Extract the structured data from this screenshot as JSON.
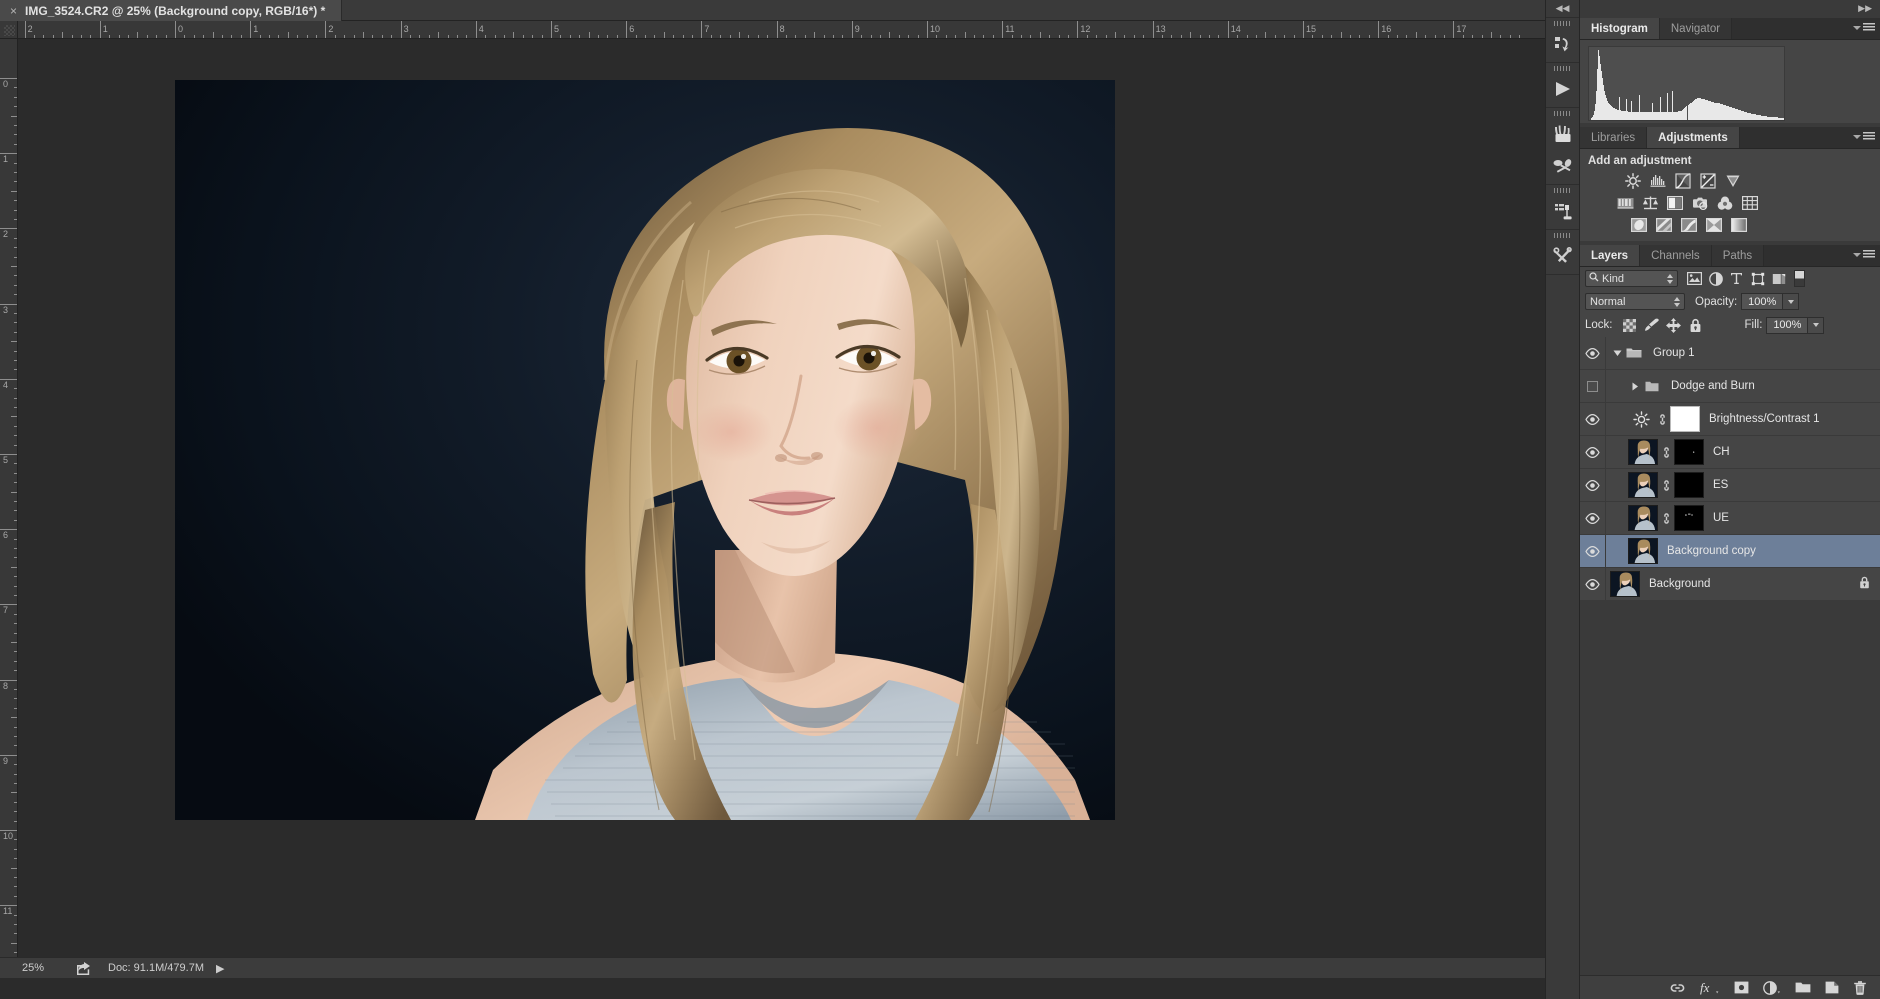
{
  "app": {
    "name": "Adobe Photoshop"
  },
  "document_tab": {
    "title": "IMG_3524.CR2 @ 25% (Background copy, RGB/16*) *",
    "close_glyph": "×"
  },
  "rulers": {
    "unit": "inches",
    "horizontal_labels": [
      "2",
      "1",
      "0",
      "1",
      "2",
      "3",
      "4",
      "5",
      "6",
      "7",
      "8",
      "9",
      "10",
      "11",
      "12",
      "13",
      "14",
      "15",
      "16",
      "17"
    ],
    "vertical_labels": [
      "0",
      "1",
      "2",
      "3",
      "4",
      "5",
      "6",
      "7",
      "8",
      "9",
      "10",
      "11"
    ]
  },
  "canvas": {
    "photo_alt": "Studio portrait of a young woman with shoulder-length blonde hair wearing a light grey knit sleeveless top on a dark navy background",
    "background_color": "#0b1420",
    "skin_color": "#e8c6ae",
    "hair_color": "#b49468",
    "garment_color": "#b9c3cc",
    "canvas_matte": "#2b2b2b"
  },
  "status_bar": {
    "zoom": "25%",
    "share_icon": "share-icon",
    "doc_info": "Doc: 91.1M/479.7M",
    "expand_arrow": "▶"
  },
  "dock": {
    "collapse_glyph": "◀◀",
    "buttons": [
      {
        "name": "history-icon",
        "tip": "History"
      },
      {
        "name": "actions-play-icon",
        "tip": "Actions"
      },
      {
        "name": "brushes-icon",
        "tip": "Brushes"
      },
      {
        "name": "brush-presets-icon",
        "tip": "Brush Presets"
      },
      {
        "name": "clone-source-icon",
        "tip": "Clone Source"
      },
      {
        "name": "tool-presets-icon",
        "tip": "Tool Presets"
      }
    ]
  },
  "panels": {
    "collapse_arrows": "▶▶",
    "histogram": {
      "tabs": [
        {
          "label": "Histogram",
          "active": true
        },
        {
          "label": "Navigator",
          "active": false
        }
      ],
      "warning_icon": "uncached-data-warning-icon",
      "bars": [
        2,
        3,
        5,
        9,
        16,
        30,
        52,
        72,
        66,
        58,
        50,
        43,
        36,
        30,
        26,
        23,
        20,
        18,
        16,
        15,
        14,
        13,
        12,
        12,
        11,
        11,
        10,
        10,
        24,
        10,
        9,
        9,
        9,
        9,
        22,
        9,
        8,
        8,
        8,
        20,
        8,
        8,
        8,
        8,
        8,
        8,
        8,
        26,
        8,
        8,
        8,
        8,
        8,
        8,
        8,
        8,
        8,
        8,
        8,
        8,
        18,
        8,
        8,
        8,
        8,
        8,
        8,
        8,
        24,
        8,
        8,
        8,
        8,
        8,
        8,
        28,
        8,
        8,
        8,
        8,
        30,
        8,
        8,
        8,
        8,
        8,
        9,
        9,
        9,
        9,
        10,
        11,
        12,
        13,
        14,
        15,
        16,
        17,
        18,
        19,
        20,
        21,
        22,
        22,
        23,
        23,
        23,
        23,
        22,
        22,
        22,
        22,
        21,
        21,
        21,
        20,
        20,
        20,
        19,
        19,
        19,
        18,
        18,
        18,
        17,
        17,
        17,
        16,
        16,
        16,
        15,
        15,
        15,
        14,
        14,
        14,
        13,
        13,
        13,
        12,
        12,
        12,
        11,
        11,
        11,
        10,
        10,
        10,
        9,
        9,
        9,
        8,
        8,
        8,
        7,
        7,
        7,
        7,
        6,
        6,
        6,
        6,
        5,
        5,
        5,
        5,
        5,
        4,
        4,
        4,
        4,
        4,
        4,
        3,
        3,
        3,
        3,
        3,
        3,
        3,
        3,
        3,
        3,
        3,
        2,
        2,
        2,
        2,
        2,
        2
      ]
    },
    "adjustments": {
      "tabs": [
        {
          "label": "Libraries",
          "active": false
        },
        {
          "label": "Adjustments",
          "active": true
        }
      ],
      "heading": "Add an adjustment",
      "row1": [
        {
          "name": "brightness-contrast-adjustment-icon",
          "tip": "Brightness/Contrast"
        },
        {
          "name": "levels-adjustment-icon",
          "tip": "Levels"
        },
        {
          "name": "curves-adjustment-icon",
          "tip": "Curves"
        },
        {
          "name": "exposure-adjustment-icon",
          "tip": "Exposure"
        },
        {
          "name": "vibrance-adjustment-icon",
          "tip": "Vibrance"
        }
      ],
      "row2": [
        {
          "name": "hue-saturation-adjustment-icon",
          "tip": "Hue/Saturation"
        },
        {
          "name": "color-balance-adjustment-icon",
          "tip": "Color Balance"
        },
        {
          "name": "black-white-adjustment-icon",
          "tip": "Black & White"
        },
        {
          "name": "photo-filter-adjustment-icon",
          "tip": "Photo Filter"
        },
        {
          "name": "channel-mixer-adjustment-icon",
          "tip": "Channel Mixer"
        },
        {
          "name": "color-lookup-adjustment-icon",
          "tip": "Color Lookup"
        }
      ],
      "row3": [
        {
          "name": "invert-adjustment-icon",
          "tip": "Invert"
        },
        {
          "name": "posterize-adjustment-icon",
          "tip": "Posterize"
        },
        {
          "name": "threshold-adjustment-icon",
          "tip": "Threshold"
        },
        {
          "name": "selective-color-adjustment-icon",
          "tip": "Selective Color"
        },
        {
          "name": "gradient-map-adjustment-icon",
          "tip": "Gradient Map"
        }
      ]
    },
    "layers": {
      "tabs": [
        {
          "label": "Layers",
          "active": true
        },
        {
          "label": "Channels",
          "active": false
        },
        {
          "label": "Paths",
          "active": false
        }
      ],
      "filter": {
        "kind_label": "Kind",
        "search_icon": "search-icon",
        "type_filters": [
          {
            "name": "filter-pixel-layers-icon"
          },
          {
            "name": "filter-adjustment-layers-icon"
          },
          {
            "name": "filter-type-layers-icon"
          },
          {
            "name": "filter-shape-layers-icon"
          },
          {
            "name": "filter-smart-object-layers-icon"
          }
        ],
        "toggle_name": "filter-enable-toggle"
      },
      "blend_mode": "Normal",
      "opacity_label": "Opacity:",
      "opacity_value": "100%",
      "lock_label": "Lock:",
      "lock_buttons": [
        {
          "name": "lock-transparent-pixels-icon"
        },
        {
          "name": "lock-image-pixels-icon"
        },
        {
          "name": "lock-position-icon"
        },
        {
          "name": "lock-all-icon"
        }
      ],
      "fill_label": "Fill:",
      "fill_value": "100%",
      "rows": [
        {
          "name": "Group 1",
          "type": "group",
          "visible": true,
          "expanded": true,
          "indent": 0,
          "selected": false,
          "locked": false
        },
        {
          "name": "Dodge and Burn",
          "type": "group",
          "visible": false,
          "expanded": false,
          "indent": 1,
          "selected": false,
          "locked": false
        },
        {
          "name": "Brightness/Contrast 1",
          "type": "adjustment",
          "visible": true,
          "indent": 1,
          "selected": false,
          "locked": false,
          "mask": "white",
          "linked": true
        },
        {
          "name": "CH",
          "type": "pixel",
          "visible": true,
          "indent": 1,
          "selected": false,
          "locked": false,
          "mask": "black",
          "linked": true
        },
        {
          "name": "ES",
          "type": "pixel",
          "visible": true,
          "indent": 1,
          "selected": false,
          "locked": false,
          "mask": "black",
          "linked": true
        },
        {
          "name": "UE",
          "type": "pixel",
          "visible": true,
          "indent": 1,
          "selected": false,
          "locked": false,
          "mask": "black",
          "linked": true
        },
        {
          "name": "Background copy",
          "type": "pixel",
          "visible": true,
          "indent": 1,
          "selected": true,
          "locked": false,
          "mask": null,
          "linked": false
        },
        {
          "name": "Background",
          "type": "pixel",
          "visible": true,
          "indent": 0,
          "selected": false,
          "locked": true,
          "mask": null,
          "linked": false
        }
      ],
      "footer_buttons": [
        {
          "name": "link-layers-icon"
        },
        {
          "name": "layer-style-fx-icon"
        },
        {
          "name": "add-layer-mask-icon"
        },
        {
          "name": "new-adjustment-layer-icon"
        },
        {
          "name": "new-group-icon"
        },
        {
          "name": "new-layer-icon"
        },
        {
          "name": "delete-layer-icon"
        }
      ]
    }
  },
  "colors": {
    "chrome": "#3a3a3a",
    "panel_body": "#454545",
    "selection_blue": "#6d7f99",
    "text": "#e0e0e0",
    "accent_highlight": "#eaeaea"
  }
}
